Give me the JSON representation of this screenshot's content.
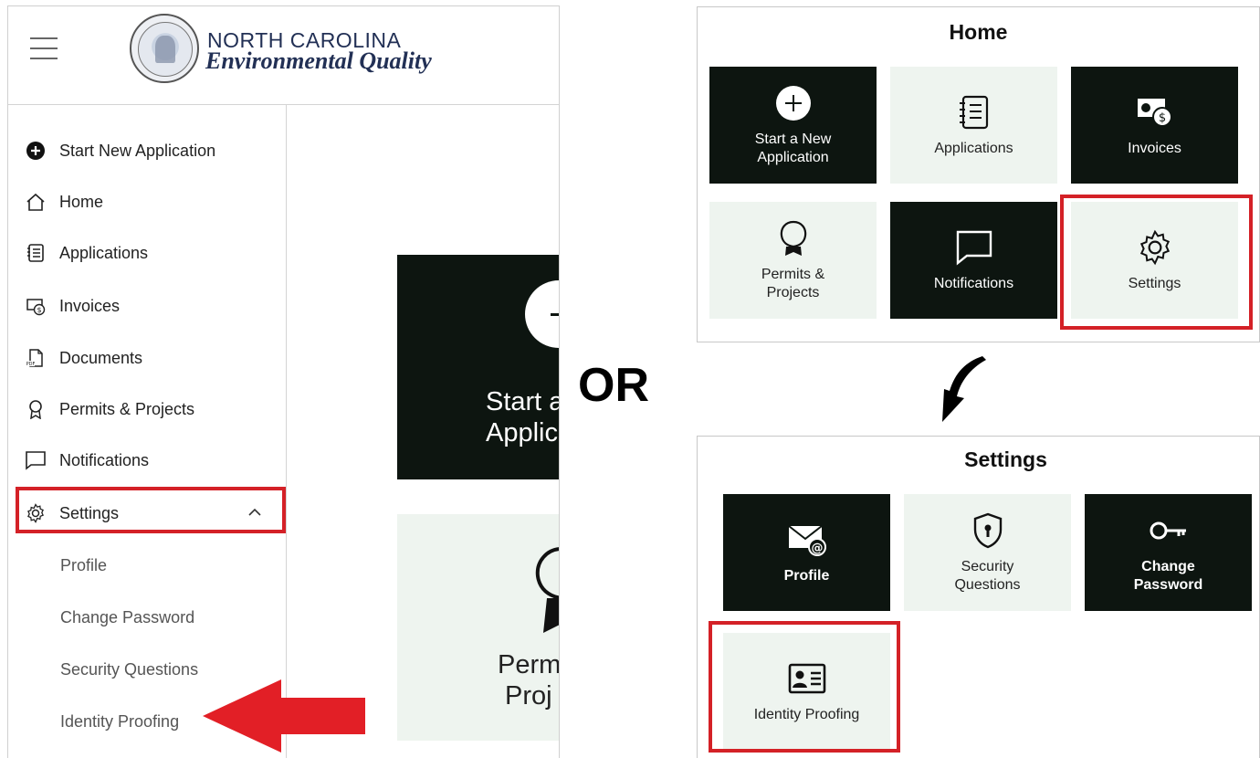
{
  "header": {
    "org_line1": "NORTH CAROLINA",
    "org_line2": "Environmental Quality"
  },
  "sidebar": {
    "items": [
      {
        "label": "Start New Application",
        "icon": "plus-circle-icon"
      },
      {
        "label": "Home",
        "icon": "home-icon"
      },
      {
        "label": "Applications",
        "icon": "applications-icon"
      },
      {
        "label": "Invoices",
        "icon": "invoice-icon"
      },
      {
        "label": "Documents",
        "icon": "pdf-document-icon"
      },
      {
        "label": "Permits & Projects",
        "icon": "ribbon-icon"
      },
      {
        "label": "Notifications",
        "icon": "chat-icon"
      },
      {
        "label": "Settings",
        "icon": "gear-icon",
        "expanded": true
      }
    ],
    "settings_subitems": [
      "Profile",
      "Change Password",
      "Security Questions",
      "Identity Proofing"
    ]
  },
  "main_preview": {
    "tile1_line1": "Start a",
    "tile1_line2": "Applic",
    "tile2_line1": "Perm",
    "tile2_line2": "Proj"
  },
  "or_label": "OR",
  "home_panel": {
    "title": "Home",
    "tiles": [
      {
        "label": "Start a New Application",
        "style": "dark"
      },
      {
        "label": "Applications",
        "style": "light"
      },
      {
        "label": "Invoices",
        "style": "dark"
      },
      {
        "label": "Permits & Projects",
        "style": "light"
      },
      {
        "label": "Notifications",
        "style": "dark"
      },
      {
        "label": "Settings",
        "style": "light"
      }
    ]
  },
  "settings_panel": {
    "title": "Settings",
    "tiles": [
      {
        "label": "Profile",
        "style": "dark"
      },
      {
        "label": "Security Questions",
        "style": "light"
      },
      {
        "label": "Change Password",
        "style": "dark"
      },
      {
        "label": "Identity Proofing",
        "style": "light"
      }
    ]
  },
  "colors": {
    "dark_tile": "#0d1510",
    "light_tile": "#eef4ef",
    "highlight_red": "#d42127",
    "brand_navy": "#223055"
  }
}
